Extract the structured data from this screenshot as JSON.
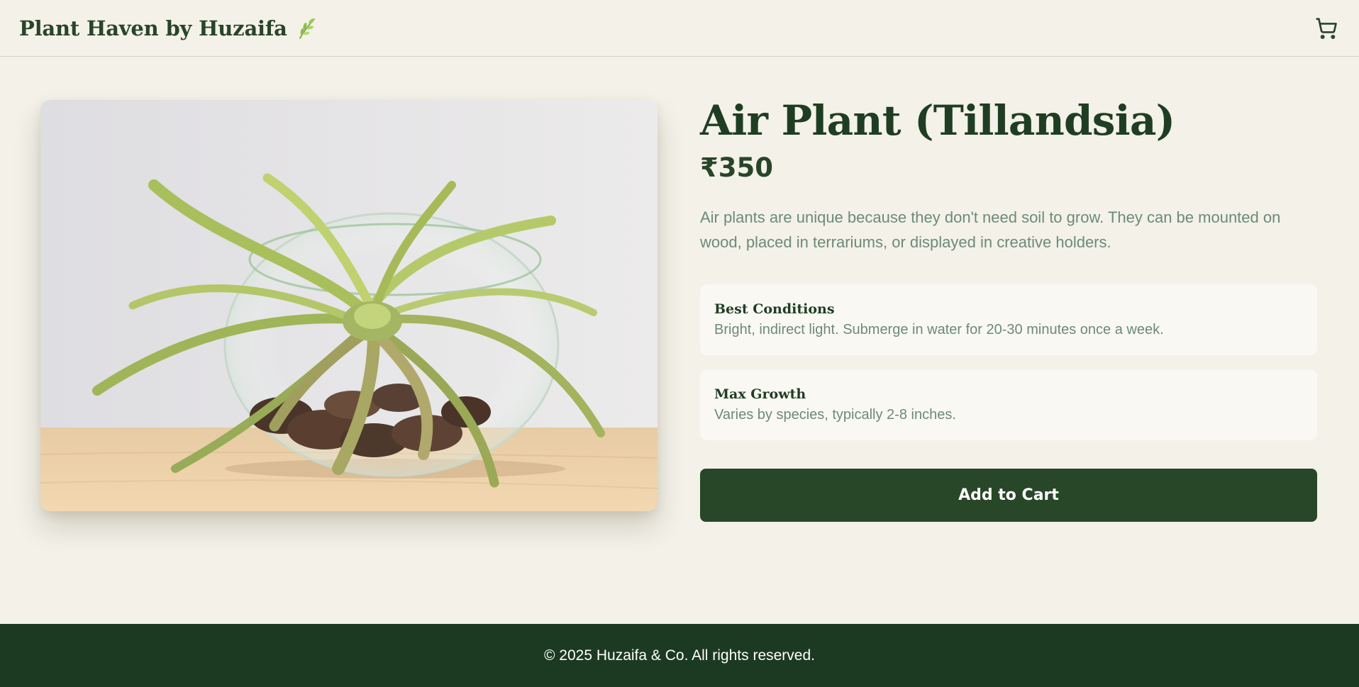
{
  "header": {
    "brand": "Plant Haven by Huzaifa",
    "brand_icon": "leaf-icon",
    "cart_icon": "cart-icon"
  },
  "product": {
    "title": "Air Plant (Tillandsia)",
    "price": "₹350",
    "description": "Air plants are unique because they don't need soil to grow. They can be mounted on wood, placed in terrariums, or displayed in creative holders.",
    "specs": [
      {
        "title": "Best Conditions",
        "text": "Bright, indirect light. Submerge in water for 20-30 minutes once a week."
      },
      {
        "title": "Max Growth",
        "text": "Varies by species, typically 2-8 inches."
      }
    ],
    "add_to_cart_label": "Add to Cart"
  },
  "footer": {
    "text": "© 2025 Huzaifa & Co. All rights reserved."
  },
  "colors": {
    "page_background": "#f3f1e8",
    "brand_green": "#284529",
    "muted_text": "#6d8a78",
    "button_green": "#284729",
    "footer_green": "#1c3a22"
  }
}
